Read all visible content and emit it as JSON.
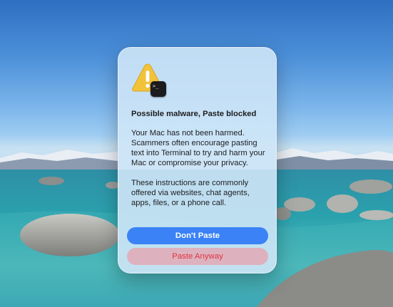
{
  "dialog": {
    "title": "Possible malware, Paste blocked",
    "paragraph_1": "Your Mac has not been harmed. Scammers often encourage pasting text into Terminal to try and harm your Mac or compromise your privacy.",
    "paragraph_2": "These instructions are commonly offered via websites, chat agents, apps, files, or a phone call.",
    "primary_button": "Don't Paste",
    "secondary_button": "Paste Anyway",
    "icons": [
      "warning-icon",
      "terminal-icon"
    ],
    "terminal_glyph": ">_"
  },
  "colors": {
    "primary_button": "#3a82f6",
    "destructive_text": "#e0343f",
    "warning_yellow": "#f2c23a"
  }
}
